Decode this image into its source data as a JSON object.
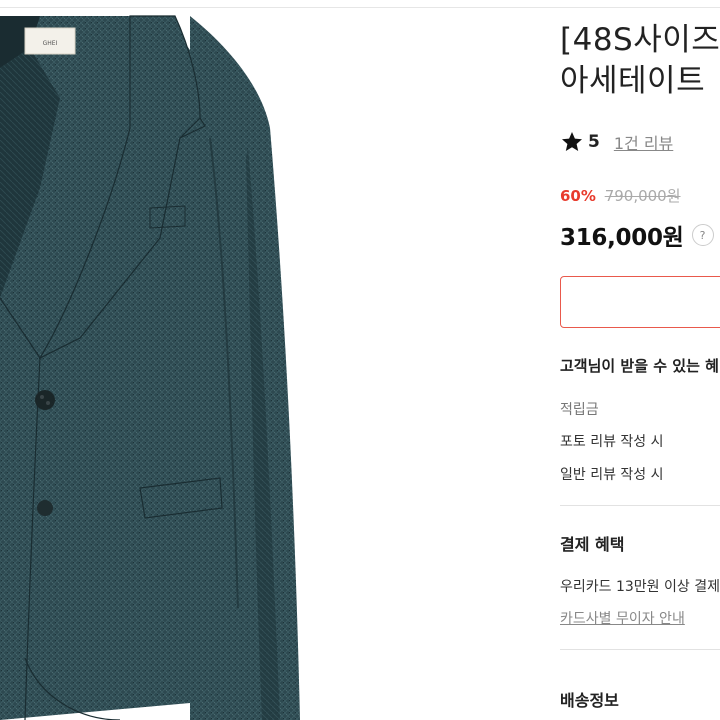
{
  "product": {
    "title_line1": "[48S사이즈",
    "title_line2": "아세테이트",
    "image_label": "GHEI",
    "rating_score": "5",
    "review_link": "1건 리뷰",
    "discount": "60%",
    "original_price": "790,000원",
    "price": "316,000원",
    "help_label": "?"
  },
  "benefits": {
    "heading": "고객님이 받을 수 있는 혜",
    "points_label": "적립금",
    "photo_review": "포토 리뷰 작성 시",
    "general_review": "일반 리뷰 작성 시"
  },
  "payment": {
    "heading": "결제 혜택",
    "card_offer": "우리카드 13만원 이상 결제",
    "card_link": "카드사별 무이자 안내"
  },
  "shipping": {
    "heading": "배송정보"
  },
  "colors": {
    "accent": "#e83b2d",
    "jacket": "#2e4a52"
  },
  "icons": {
    "rating": "star-icon",
    "help": "question-icon"
  }
}
